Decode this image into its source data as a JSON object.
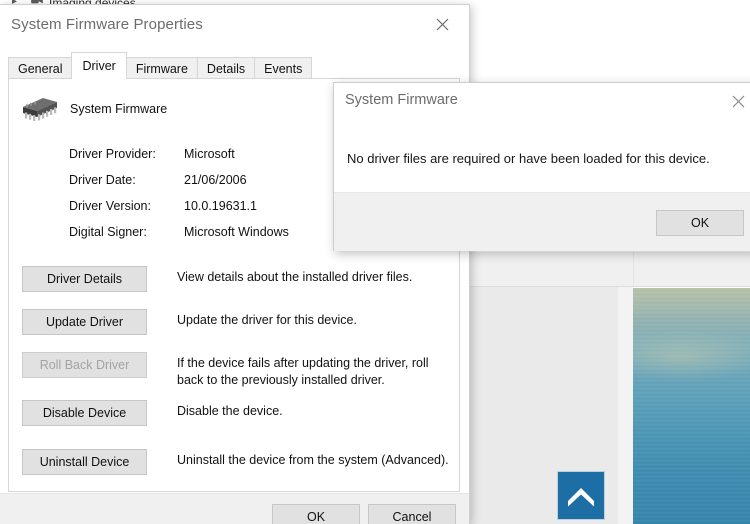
{
  "background": {
    "device_manager": {
      "tree_item_label": "Imaging devices",
      "camera_icon": "camera-icon",
      "expand_icon": "chevron-right-icon"
    },
    "scroll_top_button": {
      "icon": "chevron-up-icon",
      "color": "#1c6ea4"
    },
    "wallpaper": {
      "name": "desktop-wallpaper",
      "accent": "#3f8db2"
    }
  },
  "properties_window": {
    "title": "System Firmware Properties",
    "close_icon": "close-icon",
    "tabs": [
      {
        "label": "General",
        "selected": false
      },
      {
        "label": "Driver",
        "selected": true
      },
      {
        "label": "Firmware",
        "selected": false
      },
      {
        "label": "Details",
        "selected": false
      },
      {
        "label": "Events",
        "selected": false
      }
    ],
    "device": {
      "icon": "chip-icon",
      "name": "System Firmware"
    },
    "driver_info": [
      {
        "label": "Driver Provider:",
        "value": "Microsoft"
      },
      {
        "label": "Driver Date:",
        "value": "21/06/2006"
      },
      {
        "label": "Driver Version:",
        "value": "10.0.19631.1"
      },
      {
        "label": "Digital Signer:",
        "value": "Microsoft Windows"
      }
    ],
    "actions": [
      {
        "button": "Driver Details",
        "description": "View details about the installed driver files.",
        "disabled": false
      },
      {
        "button": "Update Driver",
        "description": "Update the driver for this device.",
        "disabled": false
      },
      {
        "button": "Roll Back Driver",
        "description": "If the device fails after updating the driver, roll back to the previously installed driver.",
        "disabled": true
      },
      {
        "button": "Disable Device",
        "description": "Disable the device.",
        "disabled": false
      },
      {
        "button": "Uninstall Device",
        "description": "Uninstall the device from the system (Advanced).",
        "disabled": false
      }
    ],
    "footer": {
      "ok": "OK",
      "cancel": "Cancel"
    }
  },
  "message_dialog": {
    "title": "System Firmware",
    "close_icon": "close-icon",
    "message": "No driver files are required or have been loaded for this device.",
    "ok": "OK"
  }
}
